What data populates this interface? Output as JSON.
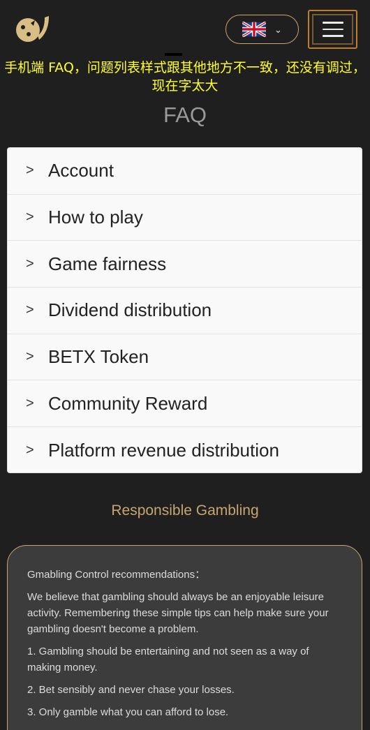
{
  "header": {
    "language": "English",
    "language_chevron": "⌄"
  },
  "annotation_text": "手机端 FAQ，问题列表样式跟其他地方不一致，还没有调过，现在字太大",
  "faq": {
    "title": "FAQ",
    "items": [
      {
        "arrow": ">",
        "label": "Account"
      },
      {
        "arrow": ">",
        "label": "How to play"
      },
      {
        "arrow": ">",
        "label": "Game fairness"
      },
      {
        "arrow": ">",
        "label": "Dividend distribution"
      },
      {
        "arrow": ">",
        "label": "BETX Token"
      },
      {
        "arrow": ">",
        "label": "Community Reward"
      },
      {
        "arrow": ">",
        "label": "Platform revenue distribution"
      }
    ]
  },
  "responsible": {
    "title": "Responsible Gambling",
    "heading": "Gmabling Control recommendations：",
    "intro": "We believe that gambling should always be an enjoyable leisure activity. Remembering these simple tips can help make sure your gambling doesn't become a problem.",
    "tips": [
      "1. Gambling should be entertaining and not seen as a way of making money.",
      "2. Bet sensibly and never chase your losses.",
      "3. Only gamble what you can afford to lose."
    ]
  },
  "colors": {
    "background": "#1f1f1f",
    "accent_gold": "#c6a670",
    "annotation_yellow": "#ffff2a",
    "menu_border_orange": "#c17c2c"
  }
}
